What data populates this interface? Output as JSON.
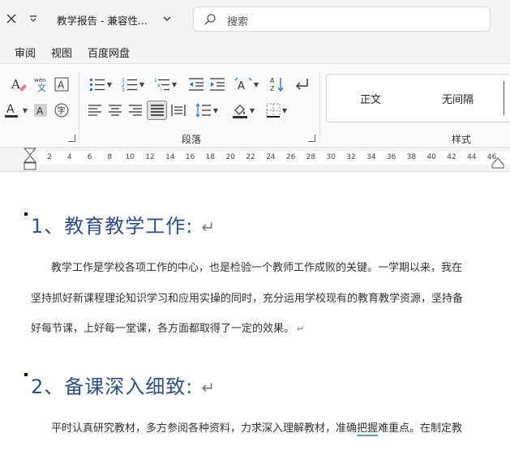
{
  "titlebar": {
    "doc_title": "教学报告 - 兼容性...",
    "search_placeholder": "搜索"
  },
  "menu": {
    "items": [
      "审阅",
      "视图",
      "百度网盘"
    ]
  },
  "ribbon": {
    "groups": {
      "paragraph": "段落",
      "styles": "样式"
    },
    "styles": [
      "正文",
      "无间隔"
    ]
  },
  "ruler": {
    "marks": [
      "2",
      "4",
      "6",
      "8",
      "10",
      "12",
      "14",
      "16",
      "18",
      "20",
      "22",
      "24",
      "26",
      "28",
      "30",
      "32",
      "34",
      "36",
      "38",
      "40",
      "42",
      "44",
      "46"
    ]
  },
  "document": {
    "heading1": "1、教育教学工作:",
    "para1": [
      "教学工作是学校各项工作的中心，也是检验一个教师工作成败的关键。一学期以来，我在",
      "坚持抓好新课程理论知识学习和应用实操的同时，充分运用学校现有的教育教学资源，坚持备",
      "好每节课，上好每一堂课，各方面都取得了一定的效果。"
    ],
    "heading2": "2、备课深入细致:",
    "para2_a": "平时认真研究教材，多方参阅各种资料，力求深入理解教材，准确",
    "para2_b": "把握",
    "para2_c": "难重点。在制定教",
    "paragraph_mark": "↵"
  }
}
